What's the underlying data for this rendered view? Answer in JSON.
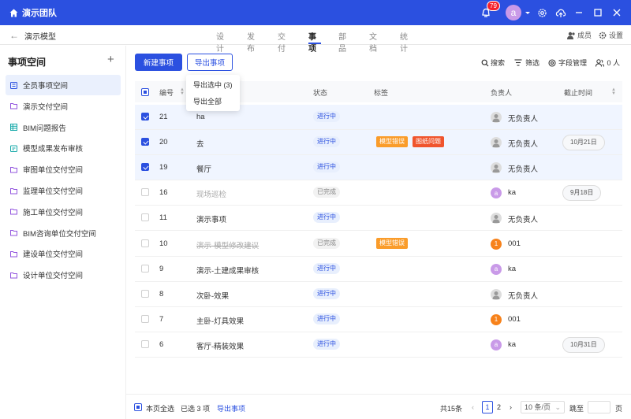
{
  "topbar": {
    "team": "演示团队",
    "badge_count": "79",
    "avatar_letter": "a"
  },
  "subbar": {
    "back": "←",
    "project": "演示模型",
    "tabs": [
      "设计",
      "发布",
      "交付",
      "事项",
      "部品",
      "文档",
      "统计"
    ],
    "active_tab": "事项",
    "members": "成员",
    "settings": "设置"
  },
  "sidebar": {
    "title": "事项空间",
    "add": "+",
    "items": [
      {
        "label": "全员事项空间",
        "icon": "doc-icon",
        "active": true
      },
      {
        "label": "演示交付空间",
        "icon": "folder-icon"
      },
      {
        "label": "BIM问题报告",
        "icon": "grid-icon"
      },
      {
        "label": "模型成果发布审核",
        "icon": "clipboard-icon"
      },
      {
        "label": "审图单位交付空间",
        "icon": "folder-icon"
      },
      {
        "label": "监理单位交付空间",
        "icon": "folder-icon"
      },
      {
        "label": "施工单位交付空间",
        "icon": "folder-icon"
      },
      {
        "label": "BIM咨询单位交付空间",
        "icon": "folder-icon"
      },
      {
        "label": "建设单位交付空间",
        "icon": "folder-icon"
      },
      {
        "label": "设计单位交付空间",
        "icon": "folder-icon"
      }
    ]
  },
  "toolbar": {
    "new_item": "新建事项",
    "export": "导出事项",
    "search": "搜索",
    "filter": "筛选",
    "fields": "字段管理",
    "people": "0 人"
  },
  "export_menu": {
    "selected": "导出选中 (3)",
    "all": "导出全部"
  },
  "table": {
    "headers": {
      "id": "编号",
      "status": "状态",
      "tags": "标签",
      "owner": "负责人",
      "due": "截止时间"
    },
    "rows": [
      {
        "id": "21",
        "title": "ha",
        "status": "进行中",
        "tags": [],
        "owner": "无负责人",
        "due": "",
        "checked": true
      },
      {
        "id": "20",
        "title": "去",
        "status": "进行中",
        "tags": [
          "模型错误",
          "图纸问题"
        ],
        "owner": "无负责人",
        "due": "10月21日",
        "checked": true
      },
      {
        "id": "19",
        "title": "餐厅",
        "status": "进行中",
        "tags": [],
        "owner": "无负责人",
        "due": "",
        "checked": true
      },
      {
        "id": "16",
        "title": "现场巡检",
        "status": "已完成",
        "tags": [],
        "owner": "ka",
        "due": "9月18日",
        "checked": false
      },
      {
        "id": "11",
        "title": "演示事项",
        "status": "进行中",
        "tags": [],
        "owner": "无负责人",
        "due": "",
        "checked": false
      },
      {
        "id": "10",
        "title": "演示-模型修改建议",
        "status": "已完成",
        "tags": [
          "模型错误"
        ],
        "owner": "001",
        "due": "",
        "checked": false
      },
      {
        "id": "9",
        "title": "演示-土建成果审核",
        "status": "进行中",
        "tags": [],
        "owner": "ka",
        "due": "",
        "checked": false
      },
      {
        "id": "8",
        "title": "次卧-效果",
        "status": "进行中",
        "tags": [],
        "owner": "无负责人",
        "due": "",
        "checked": false
      },
      {
        "id": "7",
        "title": "主卧-灯具效果",
        "status": "进行中",
        "tags": [],
        "owner": "001",
        "due": "",
        "checked": false
      },
      {
        "id": "6",
        "title": "客厅-精装效果",
        "status": "进行中",
        "tags": [],
        "owner": "ka",
        "due": "10月31日",
        "checked": false
      }
    ]
  },
  "footer": {
    "select_page": "本页全选",
    "selected": "已选 3 项",
    "export": "导出事项",
    "total": "共15条",
    "page1": "1",
    "page2": "2",
    "page_size": "10 条/页",
    "jump": "跳至",
    "page_unit": "页"
  },
  "colors": {
    "primary": "#2b50e0",
    "tag_orange": "#fa9c2a",
    "tag_red": "#f0542d",
    "avatar_ka": "#c99ae8",
    "avatar_001": "#f7821b"
  }
}
